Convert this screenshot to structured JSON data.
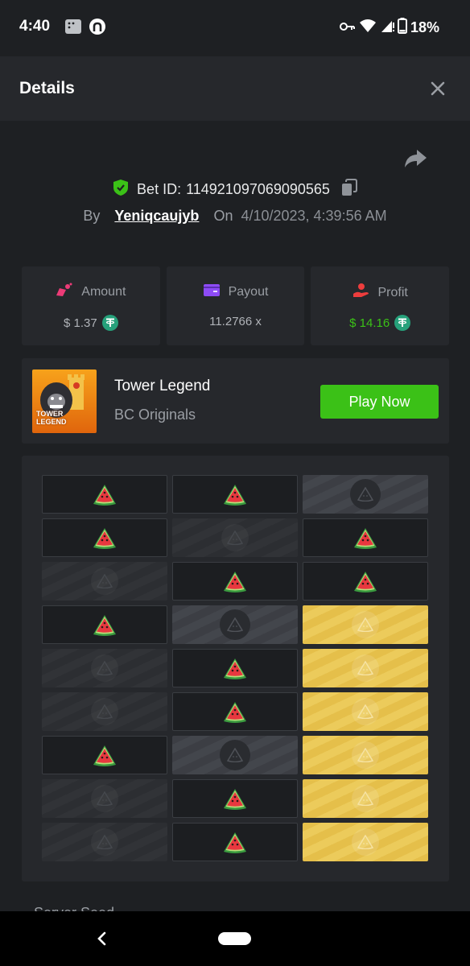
{
  "status_bar": {
    "time": "4:40",
    "battery": "18%",
    "icons": [
      "app-notification-icon",
      "github-icon",
      "vpn-key-icon",
      "wifi-icon",
      "signal-icon",
      "battery-icon"
    ]
  },
  "header": {
    "title": "Details",
    "close_icon": "close-icon"
  },
  "bet": {
    "id_label": "Bet ID:",
    "id_value": "114921097069090565",
    "by_label": "By",
    "username": "Yeniqcaujyb",
    "on_label": "On",
    "date": "4/10/2023, 4:39:56 AM"
  },
  "stats": {
    "amount": {
      "label": "Amount",
      "value": "$ 1.37",
      "currency_icon": "usdt-icon"
    },
    "payout": {
      "label": "Payout",
      "value": "11.2766 x"
    },
    "profit": {
      "label": "Profit",
      "value": "$ 14.16",
      "currency_icon": "usdt-icon"
    }
  },
  "game": {
    "name": "Tower Legend",
    "provider": "BC Originals",
    "thumb_text": "TOWER LEGEND",
    "play_label": "Play Now"
  },
  "board": {
    "rows": [
      [
        "fruit",
        "fruit",
        "mine"
      ],
      [
        "fruit",
        "hidden",
        "fruit"
      ],
      [
        "hidden",
        "fruit",
        "fruit"
      ],
      [
        "fruit",
        "mine",
        "gold"
      ],
      [
        "hidden",
        "fruit",
        "gold"
      ],
      [
        "hidden",
        "fruit",
        "gold"
      ],
      [
        "fruit",
        "mine",
        "gold"
      ],
      [
        "hidden",
        "fruit",
        "gold"
      ],
      [
        "hidden",
        "fruit",
        "gold"
      ]
    ]
  },
  "section_peek": "Server Seed",
  "colors": {
    "accent_green": "#3bc117",
    "gold": "#e5bf4a",
    "background": "#1e2023",
    "card": "#26282c",
    "usdt": "#26a17b"
  }
}
